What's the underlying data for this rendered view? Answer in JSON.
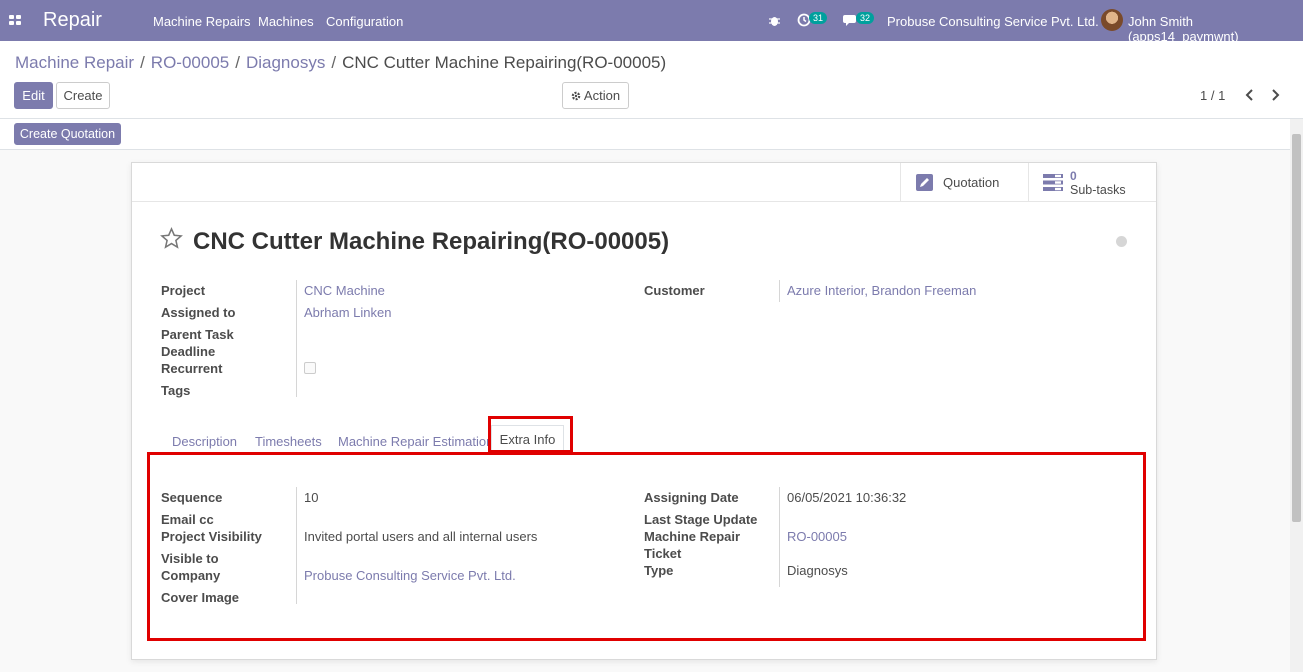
{
  "navbar": {
    "app_name": "Repair",
    "menu": [
      "Machine Repairs",
      "Machines",
      "Configuration"
    ],
    "activity_count": "31",
    "message_count": "32",
    "company": "Probuse Consulting Service Pvt. Ltd.",
    "user": "John Smith (apps14_paymwnt)"
  },
  "breadcrumb": {
    "items": [
      "Machine Repair",
      "RO-00005",
      "Diagnosys"
    ],
    "current": "CNC Cutter Machine Repairing(RO-00005)"
  },
  "buttons": {
    "edit": "Edit",
    "create": "Create",
    "action": "Action",
    "create_quotation": "Create Quotation"
  },
  "pager": "1 / 1",
  "smart_buttons": {
    "quotation": "Quotation",
    "subtasks_count": "0",
    "subtasks_label": "Sub-tasks"
  },
  "record": {
    "title": "CNC Cutter Machine Repairing(RO-00005)",
    "fields_left": [
      {
        "label": "Project",
        "value": "CNC Machine",
        "link": true
      },
      {
        "label": "Assigned to",
        "value": "Abrham Linken",
        "link": true
      },
      {
        "label": "Parent Task",
        "value": ""
      },
      {
        "label": "Deadline",
        "value": ""
      },
      {
        "label": "Recurrent",
        "value": ""
      },
      {
        "label": "Tags",
        "value": ""
      }
    ],
    "fields_right": [
      {
        "label": "Customer",
        "value": "Azure Interior, Brandon Freeman",
        "link": true
      }
    ]
  },
  "tabs": [
    "Description",
    "Timesheets",
    "Machine Repair Estimation",
    "Extra Info"
  ],
  "extra_info": {
    "left": [
      {
        "label": "Sequence",
        "value": "10"
      },
      {
        "label": "Email cc",
        "value": ""
      },
      {
        "label": "Project Visibility",
        "value": "Invited portal users and all internal users"
      },
      {
        "label": "Visible to",
        "value": ""
      },
      {
        "label": "Company",
        "value": "Probuse Consulting Service Pvt. Ltd."
      },
      {
        "label": "Cover Image",
        "value": ""
      }
    ],
    "right": [
      {
        "label": "Assigning Date",
        "value": "06/05/2021 10:36:32"
      },
      {
        "label": "Last Stage Update",
        "value": ""
      },
      {
        "label": "Machine Repair",
        "value": "RO-00005"
      },
      {
        "label": "Ticket",
        "value": ""
      },
      {
        "label": "Type",
        "value": "Diagnosys"
      }
    ]
  },
  "colors": {
    "brand": "#7c7bad",
    "highlight": "#e00000",
    "badge": "#00a09d"
  }
}
